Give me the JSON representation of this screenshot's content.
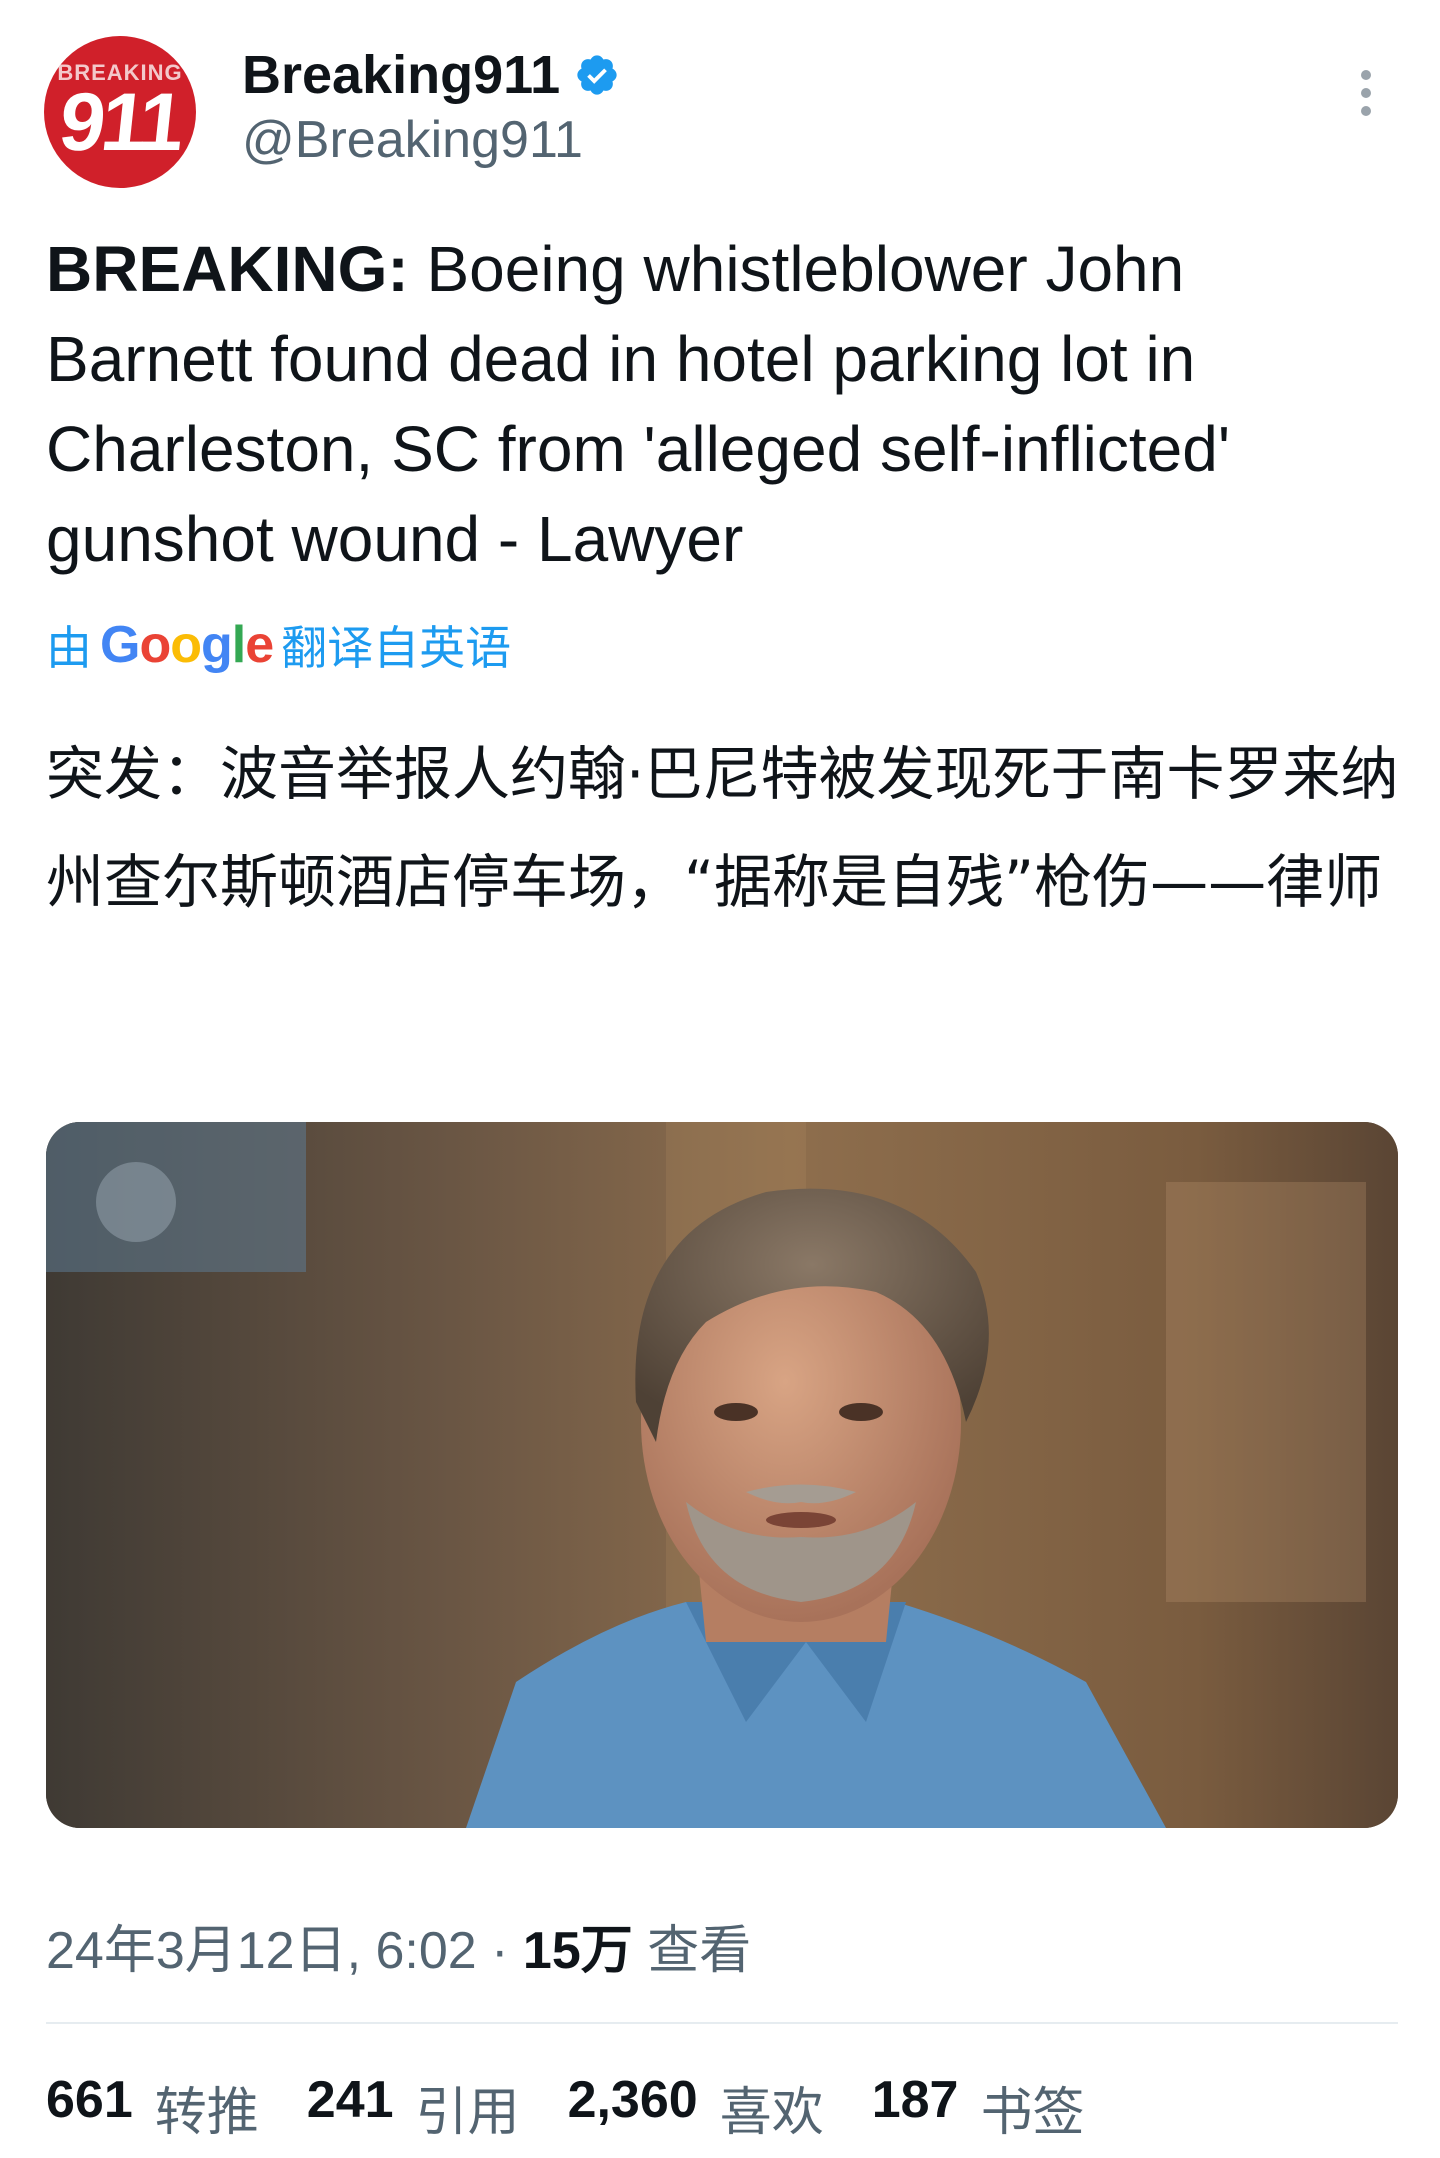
{
  "author": {
    "avatar_text_top": "BREAKING",
    "avatar_text_num": "911",
    "display_name": "Breaking911",
    "handle": "@Breaking911"
  },
  "tweet": {
    "lead": "BREAKING:",
    "body": " Boeing whistleblower John Barnett found dead in hotel parking lot in Charleston, SC from 'alleged self-inflicted' gunshot wound - Lawyer",
    "translated_prefix": "由",
    "translated_suffix": "翻译自英语",
    "translated_text": "突发：波音举报人约翰·巴尼特被发现死于南卡罗来纳州查尔斯顿酒店停车场，“据称是自残”枪伤——律师"
  },
  "meta": {
    "timestamp": "24年3月12日, 6:02",
    "separator": " · ",
    "views_count": "15万",
    "views_label": "查看"
  },
  "stats": [
    {
      "count": "661",
      "label": "转推"
    },
    {
      "count": "241",
      "label": "引用"
    },
    {
      "count": "2,360",
      "label": "喜欢"
    },
    {
      "count": "187",
      "label": "书签"
    }
  ],
  "colors": {
    "accent": "#1d9bf0",
    "avatar_bg": "#d0202a",
    "muted_text": "#536471",
    "primary_text": "#0f1419"
  },
  "icons": {
    "verified": "verified-badge-icon",
    "more": "more-options-icon"
  }
}
